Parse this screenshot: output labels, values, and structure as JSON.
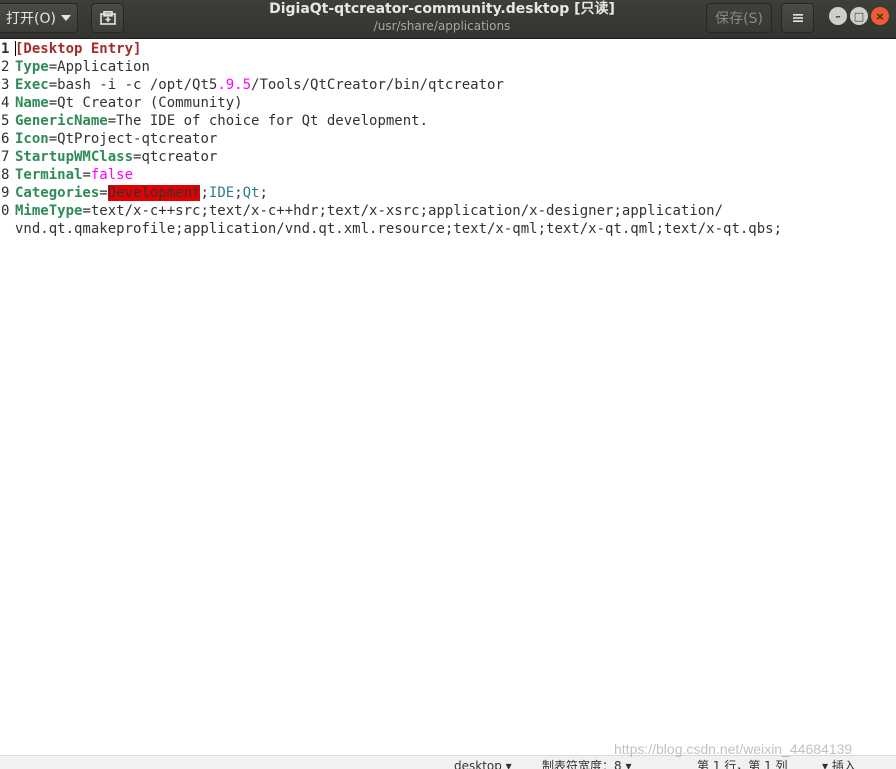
{
  "header": {
    "open_label": "打开(O)",
    "title": "DigiaQt-qtcreator-community.desktop [只读]",
    "subtitle": "/usr/share/applications",
    "save_label": "保存(S)",
    "menu_icon": "hamburger-icon",
    "newtab_icon": "new-document-icon"
  },
  "window_controls": {
    "minimize": "–",
    "maximize": "□",
    "close": "×"
  },
  "editor": {
    "line_numbers": [
      "1",
      "2",
      "3",
      "4",
      "5",
      "6",
      "7",
      "8",
      "9",
      "0"
    ],
    "lines": {
      "l1": {
        "section": "[Desktop Entry]"
      },
      "l2": {
        "key": "Type",
        "eq": "=",
        "value": "Application"
      },
      "l3": {
        "key": "Exec",
        "eq": "=",
        "v1": "bash -i -c /opt/Qt5",
        "n1": ".9.5",
        "v2": "/Tools/QtCreator/bin/qtcreator"
      },
      "l4": {
        "key": "Name",
        "eq": "=",
        "value": "Qt Creator (Community)"
      },
      "l5": {
        "key": "GenericName",
        "eq": "=",
        "value": "The IDE of choice for Qt development."
      },
      "l6": {
        "key": "Icon",
        "eq": "=",
        "value": "QtProject-qtcreator"
      },
      "l7": {
        "key": "StartupWMClass",
        "eq": "=",
        "value": "qtcreator"
      },
      "l8": {
        "key": "Terminal",
        "eq": "=",
        "value": "false"
      },
      "l9": {
        "key": "Categories",
        "eq": "=",
        "err": "Development",
        "sep1": ";",
        "c2": "IDE",
        "sep2": ";",
        "c3": "Qt",
        "sep3": ";"
      },
      "l10": {
        "key": "MimeType",
        "eq": "=",
        "value": "text/x-c++src;text/x-c++hdr;text/x-xsrc;application/x-designer;application/",
        "wrap": "vnd.qt.qmakeprofile;application/vnd.qt.xml.resource;text/x-qml;text/x-qt.qml;text/x-qt.qbs;"
      }
    }
  },
  "statusbar": {
    "language": "desktop ▾",
    "tab_width": "制表符宽度：8 ▾",
    "position": "第 1 行，第 1 列",
    "mode": "▾    插入"
  },
  "watermark": "https://blog.csdn.net/weixin_44684139",
  "colors": {
    "key": "#2e8b57",
    "section": "#a52a2a",
    "literal": "#ff00ff",
    "error_bg": "#e40000",
    "close_button": "#e85e30"
  }
}
